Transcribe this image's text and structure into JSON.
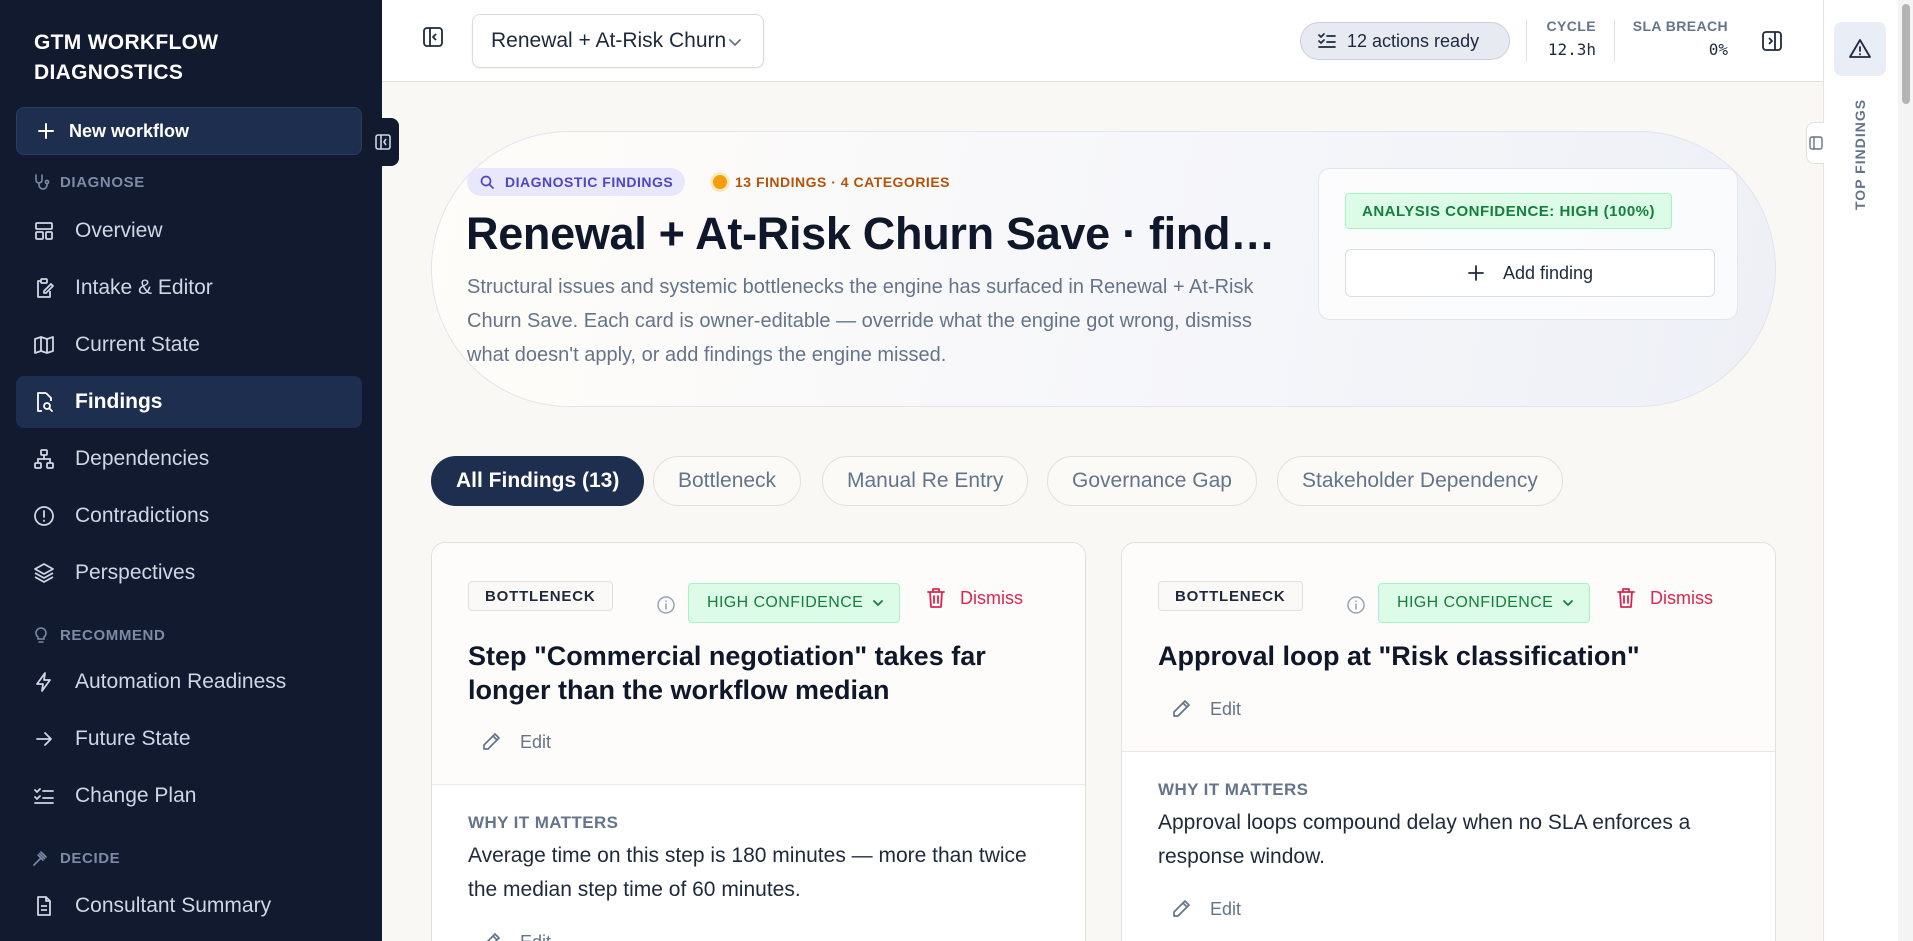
{
  "sidebar": {
    "brand": "GTM WORKFLOW DIAGNOSTICS",
    "new_workflow": "New workflow",
    "sections": {
      "diagnose": "DIAGNOSE",
      "recommend": "RECOMMEND",
      "decide": "DECIDE"
    },
    "items": [
      {
        "label": "Overview",
        "icon": "layout-icon"
      },
      {
        "label": "Intake & Editor",
        "icon": "clipboard-edit-icon"
      },
      {
        "label": "Current State",
        "icon": "map-icon"
      },
      {
        "label": "Findings",
        "icon": "file-search-icon",
        "active": true
      },
      {
        "label": "Dependencies",
        "icon": "network-icon"
      },
      {
        "label": "Contradictions",
        "icon": "alert-circle-icon"
      },
      {
        "label": "Perspectives",
        "icon": "layers-icon"
      },
      {
        "label": "Automation Readiness",
        "icon": "zap-icon"
      },
      {
        "label": "Future State",
        "icon": "arrow-right-icon"
      },
      {
        "label": "Change Plan",
        "icon": "list-checks-icon"
      },
      {
        "label": "Consultant Summary",
        "icon": "document-icon"
      }
    ]
  },
  "topbar": {
    "workflow_select": "Renewal + At-Risk Churn Save",
    "actions_ready": "12 actions ready",
    "cycle_label": "CYCLE",
    "cycle_value": "12.3h",
    "sla_label": "SLA BREACH",
    "sla_value": "0%"
  },
  "rail": {
    "label": "TOP FINDINGS"
  },
  "hero": {
    "tag": "DIAGNOSTIC FINDINGS",
    "count": "13 FINDINGS · 4 CATEGORIES",
    "title": "Renewal + At-Risk Churn Save · findings",
    "description": "Structural issues and systemic bottlenecks the engine has surfaced in Renewal + At-Risk Churn Save. Each card is owner-editable — override what the engine got wrong, dismiss what doesn't apply, or add findings the engine missed.",
    "confidence": "ANALYSIS CONFIDENCE: HIGH (100%)",
    "add_finding": "Add finding"
  },
  "filters": [
    {
      "label": "All Findings (13)",
      "active": true
    },
    {
      "label": "Bottleneck"
    },
    {
      "label": "Manual Re Entry"
    },
    {
      "label": "Governance Gap"
    },
    {
      "label": "Stakeholder Dependency"
    }
  ],
  "cards": [
    {
      "category": "BOTTLENECK",
      "confidence": "HIGH CONFIDENCE",
      "dismiss": "Dismiss",
      "title": "Step \"Commercial negotiation\" takes far longer than the workflow median",
      "edit": "Edit",
      "why_label": "WHY IT MATTERS",
      "why_text": "Average time on this step is 180 minutes — more than twice the median step time of 60 minutes.",
      "edit2": "Edit"
    },
    {
      "category": "BOTTLENECK",
      "confidence": "HIGH CONFIDENCE",
      "dismiss": "Dismiss",
      "title": "Approval loop at \"Risk classification\"",
      "edit": "Edit",
      "why_label": "WHY IT MATTERS",
      "why_text": "Approval loops compound delay when no SLA enforces a response window.",
      "edit2": "Edit"
    }
  ],
  "colors": {
    "sidebar_bg": "#111a2e",
    "active_item": "#1e2e4f",
    "confidence_green": "#15803d",
    "dismiss_red": "#dc2651",
    "accent_purple": "#4f46c4",
    "count_orange": "#b45309"
  }
}
